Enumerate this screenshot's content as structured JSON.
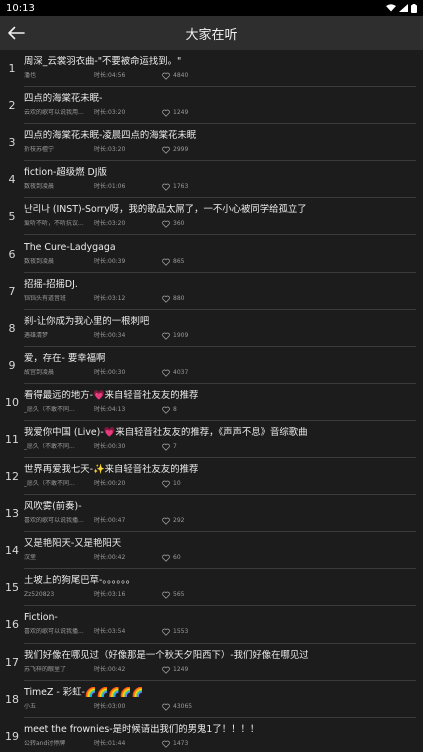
{
  "status": {
    "time": "10:13"
  },
  "header": {
    "title": "大家在听"
  },
  "icons": {
    "back": "back-arrow-icon",
    "heart": "heart-outline-icon",
    "wifi": "wifi-icon",
    "signal": "signal-icon",
    "battery": "battery-icon"
  },
  "songs": [
    {
      "rank": "1",
      "title": "周深_云裳羽衣曲-\"不要被命运找到。\"",
      "artist": "潘也",
      "duration": "时长:04:56",
      "likes": "4840"
    },
    {
      "rank": "2",
      "title": "四点的海棠花未眠-",
      "artist": "云欢的歌可以说我用...",
      "duration": "时长:03:20",
      "likes": "1249"
    },
    {
      "rank": "3",
      "title": "四点的海棠花未眠-凌晨四点的海棠花未眠",
      "artist": "折枝苏檀宁",
      "duration": "时长:03:20",
      "likes": "2999"
    },
    {
      "rank": "4",
      "title": "fiction-超级燃  DJ版",
      "artist": "数夜到凌晨",
      "duration": "时长:01:06",
      "likes": "1763"
    },
    {
      "rank": "5",
      "title": "난리나 (INST)-Sorry呀，我的歌品太屌了，一不小心被同学给孤立了",
      "artist": "爱听不听，不听抗议...",
      "duration": "时长:03:20",
      "likes": "360"
    },
    {
      "rank": "6",
      "title": "The Cure-Ladygaga",
      "artist": "数夜到凌晨",
      "duration": "时长:00:39",
      "likes": "865"
    },
    {
      "rank": "7",
      "title": "招摇-招摇DJ.",
      "artist": "铛铛头有道音班",
      "duration": "时长:03:12",
      "likes": "880"
    },
    {
      "rank": "8",
      "title": "刹-让你成为我心里的一根刺吧",
      "artist": "遇雄清梦",
      "duration": "时长:00:34",
      "likes": "1909"
    },
    {
      "rank": "9",
      "title": "爱，存在-      要幸福啊",
      "artist": "故宫到凌晨",
      "duration": "时长:00:30",
      "likes": "4037"
    },
    {
      "rank": "10",
      "title": "看得最远的地方-💗来自轻音社友友的推荐",
      "artist": "_愿久（不敢不同...",
      "duration": "时长:04:13",
      "likes": "8"
    },
    {
      "rank": "11",
      "title": "我爱你中国 (Live)-💗来自轻音社友友的推荐，《声声不息》音综歌曲",
      "artist": "_愿久（不敢不同...",
      "duration": "时长:00:30",
      "likes": "7"
    },
    {
      "rank": "12",
      "title": "世界再爱我七天-✨来自轻音社友友的推荐",
      "artist": "_愿久（不敢不同...",
      "duration": "时长:00:20",
      "likes": "10"
    },
    {
      "rank": "13",
      "title": "风吹雾(前奏)-",
      "artist": "喜欢的歌可以说我播...",
      "duration": "时长:00:47",
      "likes": "292"
    },
    {
      "rank": "14",
      "title": "又是艳阳天-又是艳阳天",
      "artist": "汉堡",
      "duration": "时长:00:42",
      "likes": "60"
    },
    {
      "rank": "15",
      "title": "土坡上的狗尾巴草-。。。。。。",
      "artist": "Zz520823",
      "duration": "时长:03:16",
      "likes": "565"
    },
    {
      "rank": "16",
      "title": "Fiction-",
      "artist": "喜欢的歌可以说我播...",
      "duration": "时长:03:54",
      "likes": "1553"
    },
    {
      "rank": "17",
      "title": "我们好像在哪见过（好像那是一个秋天夕阳西下）-我们好像在哪见过",
      "artist": "苏飞梓的眼里了",
      "duration": "时长:00:42",
      "likes": "1249"
    },
    {
      "rank": "18",
      "title": "TimeZ - 彩虹-🌈🌈🌈🌈🌈",
      "artist": "小五",
      "duration": "时长:03:00",
      "likes": "43065"
    },
    {
      "rank": "19",
      "title": "meet the frownies-是时候请出我们的男鬼1了！！！！",
      "artist": "公转and讨停牌",
      "duration": "时长:01:44",
      "likes": "1473"
    }
  ]
}
